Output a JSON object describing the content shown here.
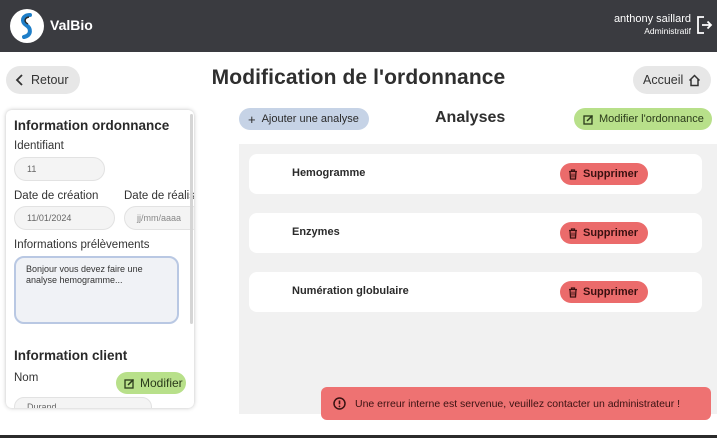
{
  "app": {
    "brand": "ValBio"
  },
  "user": {
    "name": "anthony saillard",
    "role": "Administratif"
  },
  "header": {
    "back_label": "Retour",
    "title": "Modification de l'ordonnance",
    "home_label": "Accueil"
  },
  "ordonnance": {
    "section_title": "Information ordonnance",
    "id_label": "Identifiant",
    "id_value": "11",
    "creation_label": "Date de création",
    "creation_value": "11/01/2024",
    "realisation_label": "Date de réalis",
    "realisation_placeholder": "jj/mm/aaaa",
    "prelevement_label": "Informations prélèvements",
    "prelevement_value": "Bonjour vous devez faire une analyse hemogramme..."
  },
  "client": {
    "section_title": "Information client",
    "nom_label": "Nom",
    "edit_label": "Modifier",
    "nom_value_partial": "Durand"
  },
  "analyses": {
    "add_label": "Ajouter une analyse",
    "title": "Analyses",
    "edit_ordonnance_label": "Modifier l'ordonnance",
    "items": [
      {
        "name": "Hemogramme",
        "delete_label": "Supprimer"
      },
      {
        "name": "Enzymes",
        "delete_label": "Supprimer"
      },
      {
        "name": "Numération globulaire",
        "delete_label": "Supprimer"
      }
    ]
  },
  "toast": {
    "message": "Une erreur interne est servenue, veuillez contacter un administrateur !"
  },
  "colors": {
    "topbar": "#3a3b40",
    "green_button": "#b8e08a",
    "blue_button": "#c6d3e6",
    "red_button": "#eb6b6b",
    "toast": "#ee7272"
  }
}
